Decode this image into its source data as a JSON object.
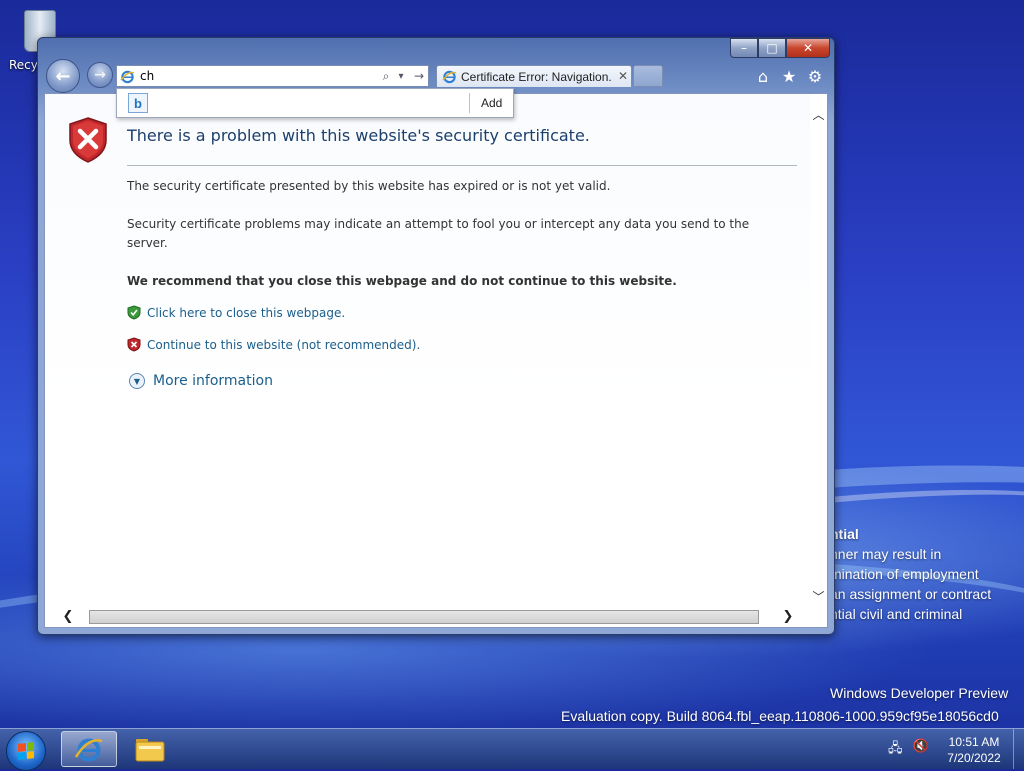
{
  "desktop": {
    "recycle_bin_label": "Recyc",
    "legal_heading": "ntial",
    "legal_lines": [
      "nner may result in",
      "mination of employment",
      "an assignment or contract",
      "ntial civil and criminal"
    ],
    "watermark_title": "Windows Developer Preview",
    "watermark_build": "Evaluation copy. Build 8064.fbl_eeap.110806-1000.959cf95e18056cd0"
  },
  "browser": {
    "window_controls": {
      "minimize": "–",
      "maximize": "□",
      "close": "✕"
    },
    "nav": {
      "back": "←",
      "forward": "→"
    },
    "address_bar": {
      "value": "ch",
      "search_glyph": "⌕",
      "dropdown_glyph": "▾",
      "go_glyph": "→"
    },
    "tab": {
      "label": "Certificate Error: Navigation...",
      "close": "✕"
    },
    "tools": {
      "home": "⌂",
      "favorites": "★",
      "settings": "⚙"
    },
    "autocomplete": {
      "provider_glyph": "b",
      "add_label": "Add"
    }
  },
  "page": {
    "heading": "There is a problem with this website's security certificate.",
    "para1": "The security certificate presented by this website has expired or is not yet valid.",
    "para2": "Security certificate problems may indicate an attempt to fool you or intercept any data you send to the server.",
    "recommend": "We recommend that you close this webpage and do not continue to this website.",
    "link_close": "Click here to close this webpage.",
    "link_continue": "Continue to this website (not recommended).",
    "more_info": "More information"
  },
  "scrollbars": {
    "up": "︿",
    "down": "﹀",
    "left": "❮",
    "right": "❯"
  },
  "taskbar": {
    "time": "10:51 AM",
    "date": "7/20/2022"
  },
  "colors": {
    "link": "#1b5e8c",
    "heading": "#1c3f6b",
    "error_red": "#c0272d",
    "safe_green": "#3b9a3b"
  }
}
